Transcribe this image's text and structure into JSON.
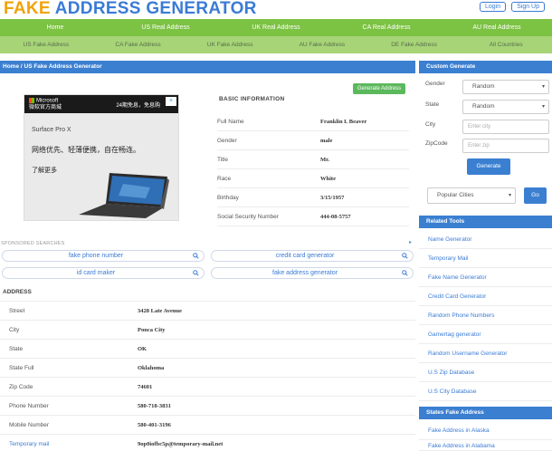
{
  "header": {
    "logo_part1": "FAKE",
    "logo_part2": "ADDRESS GENERATOR",
    "login": "Login",
    "signup": "Sign Up"
  },
  "nav_primary": [
    "Home",
    "US Real Address",
    "UK Real Address",
    "CA Real Address",
    "AU Real Address"
  ],
  "nav_secondary": [
    "US Fake Address",
    "CA Fake Address",
    "UK Fake Address",
    "AU Fake Address",
    "DE Fake Address",
    "All Countries"
  ],
  "breadcrumb": {
    "home": "Home",
    "separator": "/",
    "current": "US Fake Address Generator"
  },
  "ad": {
    "brand": "Microsoft",
    "brand_sub": "微软官方商城",
    "promo": "24期免息，免息购",
    "model": "Surface Pro X",
    "slogan": "网络优先、轻薄便携，自在畅连。",
    "learn_more": "了解更多",
    "close": "×"
  },
  "generate_button": "Generate Address",
  "basic": {
    "heading": "BASIC INFORMATION",
    "rows": [
      {
        "label": "Full Name",
        "value": "Franklin L Beaver"
      },
      {
        "label": "Gender",
        "value": "male"
      },
      {
        "label": "Title",
        "value": "Mr."
      },
      {
        "label": "Race",
        "value": "White"
      },
      {
        "label": "Birthday",
        "value": "3/15/1957"
      },
      {
        "label": "Social Security Number",
        "value": "444-08-5757"
      }
    ]
  },
  "sponsored": {
    "label": "SPONSORED SEARCHES",
    "searches": [
      "fake phone number",
      "credit card generator",
      "id card maker",
      "fake address generator"
    ]
  },
  "address": {
    "heading": "ADDRESS",
    "rows": [
      {
        "label": "Street",
        "value": "3428 Late Avenue",
        "link": false
      },
      {
        "label": "City",
        "value": "Ponca City",
        "link": false
      },
      {
        "label": "State",
        "value": "OK",
        "link": false
      },
      {
        "label": "State Full",
        "value": "Oklahoma",
        "link": false
      },
      {
        "label": "Zip Code",
        "value": "74601",
        "link": false
      },
      {
        "label": "Phone Number",
        "value": "580-718-3831",
        "link": false
      },
      {
        "label": "Mobile Number",
        "value": "580-401-3196",
        "link": false
      },
      {
        "label": "Temporary mail",
        "value": "9op0iofbc5p@temporary-mail.net",
        "link": true
      }
    ]
  },
  "sidebar": {
    "custom_heading": "Custom Generate",
    "gender_label": "Gender",
    "gender_value": "Random",
    "state_label": "State",
    "state_value": "Random",
    "city_label": "City",
    "city_placeholder": "Enter city",
    "zip_label": "ZipCode",
    "zip_placeholder": "Enter zip",
    "generate": "Generate",
    "cities_value": "Popular Cities",
    "go": "Go",
    "tools_heading": "Related Tools",
    "tools": [
      "Name Generator",
      "Temporary Mail",
      "Fake Name Generator",
      "Credit Card Generator",
      "Random Phone Numbers",
      "Gamertag generator",
      "Random Username Generator",
      "U.S Zip Database",
      "U.S City Database"
    ],
    "states_heading": "States Fake Address",
    "states": [
      "Fake Address in Alaska",
      "Fake Address in Alabama"
    ]
  },
  "colors": {
    "logo_orange": "#f0a30a",
    "logo_blue": "#3a7bd5",
    "nav_green": "#7cc243",
    "subnav_green": "#a6d477",
    "header_blue": "#3b7fd1",
    "button_green": "#5cb85c"
  }
}
